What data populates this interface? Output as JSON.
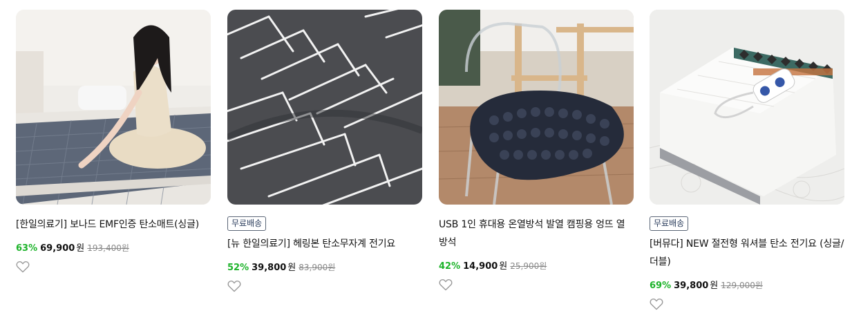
{
  "products": [
    {
      "image": "woman-sitting-on-gray-carbon-mat",
      "badge": "",
      "title": "[한일의료기] 보나드 EMF인증 탄소매트(싱글)",
      "discount": "63%",
      "price": "69,900",
      "currency": "원",
      "original_price": "193,400원"
    },
    {
      "image": "gray-herringbone-quilted-blanket",
      "badge": "무료배송",
      "title": "[뉴 한일의료기] 헤링본 탄소무자계 전기요",
      "discount": "52%",
      "price": "39,800",
      "currency": "원",
      "original_price": "83,900원"
    },
    {
      "image": "navy-heated-seat-cushion-on-clear-chair",
      "badge": "",
      "title": "USB 1인 휴대용 온열방석 발열 캠핑용 엉뜨 열방석",
      "discount": "42%",
      "price": "14,900",
      "currency": "원",
      "original_price": "25,900원"
    },
    {
      "image": "white-quilted-electric-blanket-with-controller",
      "badge": "무료배송",
      "title": "[버뮤다] NEW 절전형 워셔블 탄소 전기요 (싱글/더블)",
      "discount": "69%",
      "price": "39,800",
      "currency": "원",
      "original_price": "129,000원"
    }
  ],
  "icons": {
    "wishlist": "heart-outline-icon"
  },
  "colors": {
    "discount": "#1db32a",
    "badge_border": "#5a6576"
  }
}
